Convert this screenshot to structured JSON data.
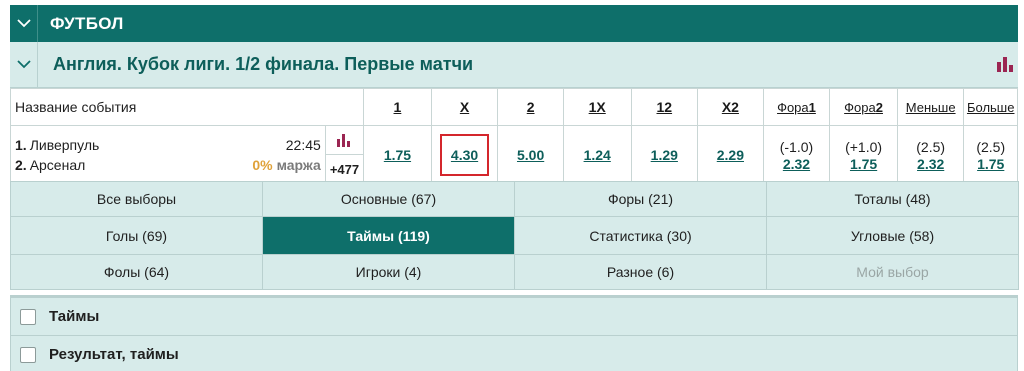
{
  "sport": {
    "title": "ФУТБОЛ"
  },
  "league": {
    "title": "Англия. Кубок лиги. 1/2 финала. Первые матчи"
  },
  "columns": {
    "event_name": "Название события",
    "c1": "1",
    "cx": "X",
    "c2": "2",
    "c1x": "1X",
    "c12": "12",
    "cx2": "X2",
    "fora1_prefix": "Фора",
    "fora1_num": "1",
    "fora2_prefix": "Фора",
    "fora2_num": "2",
    "under": "Меньше",
    "over": "Больше"
  },
  "event": {
    "team1_num": "1.",
    "team1": "Ливерпуль",
    "time": "22:45",
    "team2_num": "2.",
    "team2": "Арсенал",
    "margin_pct": "0%",
    "margin_label": "маржа",
    "more_bets": "+477",
    "odds": {
      "w1": "1.75",
      "x": "4.30",
      "w2": "5.00",
      "d1x": "1.24",
      "d12": "1.29",
      "dx2": "2.29",
      "fora1_line": "(-1.0)",
      "fora1_odd": "2.32",
      "fora2_line": "(+1.0)",
      "fora2_odd": "1.75",
      "under_line": "(2.5)",
      "under_odd": "2.32",
      "over_line": "(2.5)",
      "over_odd": "1.75"
    }
  },
  "tabs": [
    [
      "Все выборы",
      "Основные (67)",
      "Форы (21)",
      "Тоталы (48)"
    ],
    [
      "Голы (69)",
      "Таймы (119)",
      "Статистика (30)",
      "Угловые (58)"
    ],
    [
      "Фолы (64)",
      "Игроки (4)",
      "Разное (6)",
      "Мой выбор"
    ]
  ],
  "groups": [
    {
      "label": "Таймы"
    },
    {
      "label": "Результат, таймы"
    }
  ],
  "colors": {
    "header_teal": "#0e6f6a",
    "light_teal": "#d7ebea",
    "odd_text": "#0d5e5a",
    "selection_red": "#d4262c",
    "margin_orange": "#e0a23a",
    "stats_icon": "#9b2552"
  },
  "icons": {
    "sport_collapse": "chevron-down-icon",
    "league_collapse": "chevron-down-icon",
    "league_stats": "bar-chart-icon",
    "event_stats": "bar-chart-icon"
  }
}
